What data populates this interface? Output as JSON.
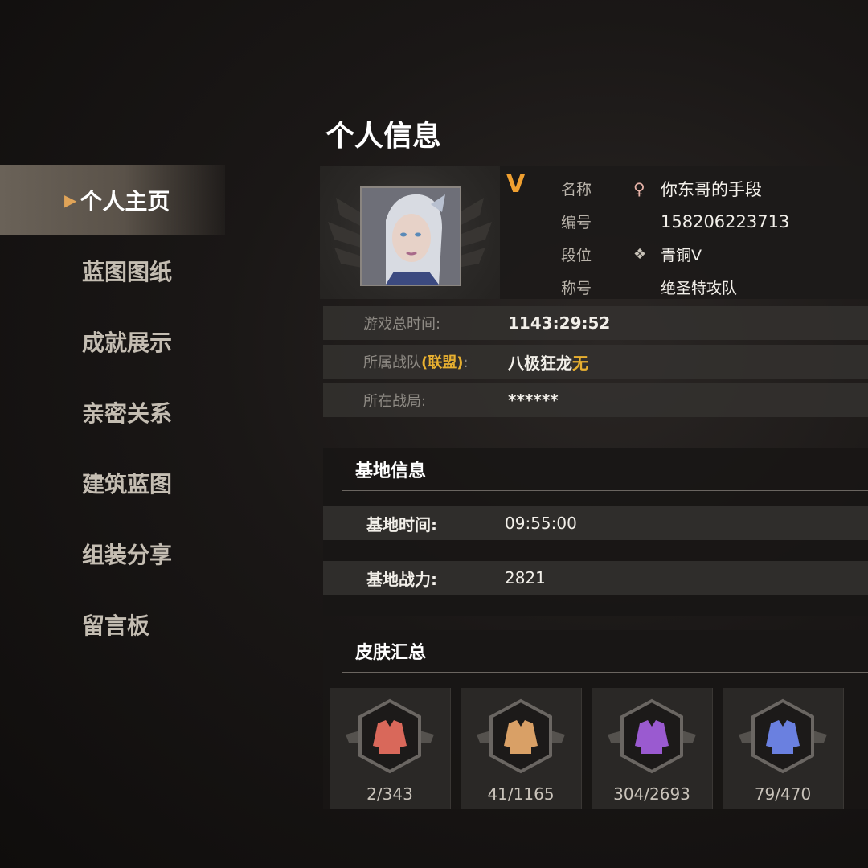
{
  "page_title": "个人信息",
  "sidebar": {
    "items": [
      {
        "label": "个人主页",
        "active": true
      },
      {
        "label": "蓝图图纸"
      },
      {
        "label": "成就展示"
      },
      {
        "label": "亲密关系"
      },
      {
        "label": "建筑蓝图"
      },
      {
        "label": "组装分享"
      },
      {
        "label": "留言板"
      }
    ]
  },
  "profile": {
    "rank_letter": "V",
    "name_label": "名称",
    "name_value": "你东哥的手段",
    "gender_icon": "female-icon",
    "id_label": "编号",
    "id_value": "158206223713",
    "tier_label": "段位",
    "tier_value": "青铜V",
    "tier_icon": "bronze-tier-icon",
    "title_label": "称号",
    "title_value": "绝圣特攻队"
  },
  "stats": {
    "playtime_label": "游戏总时间:",
    "playtime_value": "1143:29:52",
    "team_label_prefix": "所属战队",
    "team_label_union": "(联盟)",
    "team_label_colon": ":",
    "team_value": "八极狂龙",
    "union_value": "无",
    "battle_label": "所在战局:",
    "battle_value": "******"
  },
  "base": {
    "section_title": "基地信息",
    "time_label": "基地时间:",
    "time_value": "09:55:00",
    "power_label": "基地战力:",
    "power_value": "2821"
  },
  "skins": {
    "section_title": "皮肤汇总",
    "tiles": [
      {
        "count": "2/343",
        "color": "#d9685a"
      },
      {
        "count": "41/1165",
        "color": "#d9a066"
      },
      {
        "count": "304/2693",
        "color": "#9a5ad0"
      },
      {
        "count": "79/470",
        "color": "#6a80e0"
      }
    ]
  },
  "colors": {
    "accent_orange": "#f0a030",
    "union_yellow": "#e8b030"
  }
}
